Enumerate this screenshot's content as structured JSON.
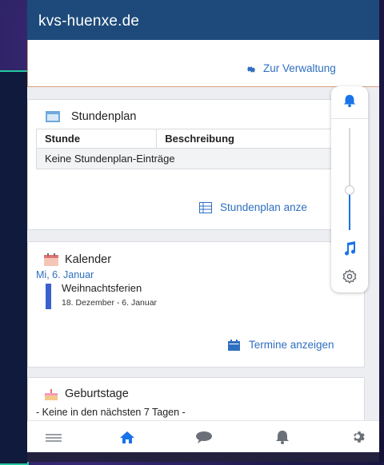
{
  "app": {
    "title": "kvs-huenxe.de"
  },
  "card_top": {
    "link_label": "Zur Verwaltung"
  },
  "stundenplan": {
    "title": "Stundenplan",
    "columns": [
      "Stunde",
      "Beschreibung"
    ],
    "empty_text": "Keine Stundenplan-Einträge",
    "link_label": "Stundenplan anze"
  },
  "kalender": {
    "title": "Kalender",
    "date": "Mi, 6. Januar",
    "event": {
      "title": "Weihnachtsferien",
      "range": "18. Dezember - 6. Januar",
      "color": "#3a5fcf"
    },
    "link_label": "Termine anzeigen"
  },
  "geburtstage": {
    "title": "Geburtstage",
    "text": "- Keine in den nächsten 7 Tagen -"
  },
  "bottom_nav": {
    "items": [
      "menu-icon",
      "home-icon",
      "chat-icon",
      "bell-icon",
      "gear-icon"
    ],
    "active": "home-icon"
  },
  "volume_panel": {
    "level": 0.38,
    "accent": "#1a73e8"
  },
  "colors": {
    "appbar": "#1d4a7a",
    "link": "#2f6fc0",
    "accent": "#1a73e8"
  }
}
